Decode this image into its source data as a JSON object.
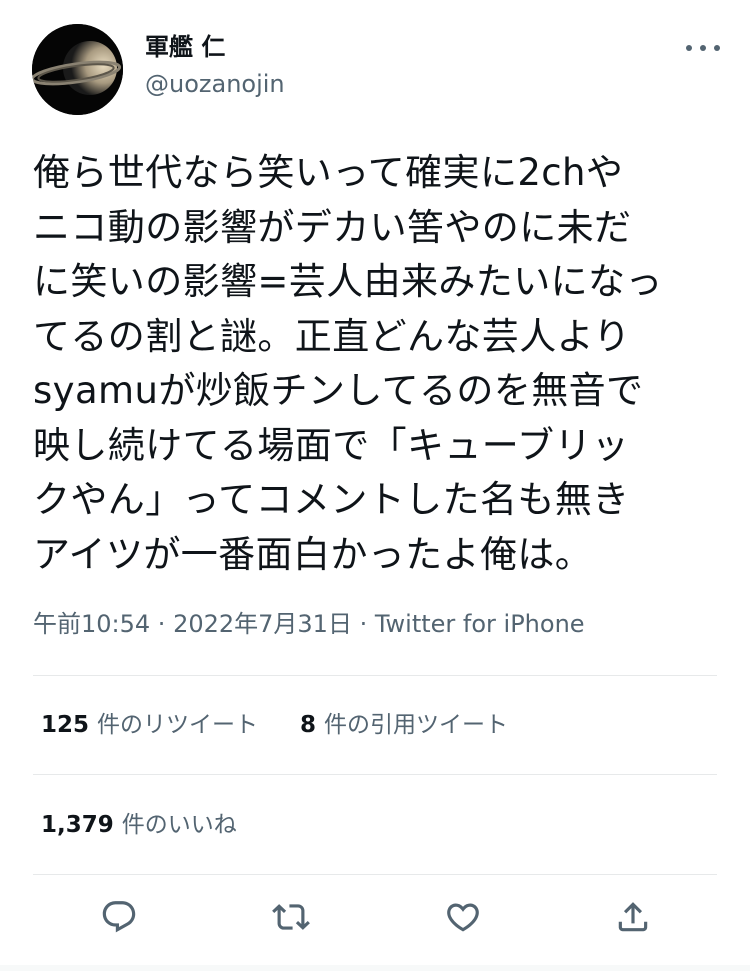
{
  "user": {
    "display_name": "軍艦 仁",
    "handle": "@uozanojin"
  },
  "tweet": {
    "text": "俺ら世代なら笑いって確実に2chや\nニコ動の影響がデカい筈やのに未だ\nに笑いの影響=芸人由来みたいになっ\nてるの割と謎。正直どんな芸人より\nsyamuが炒飯チンしてるのを無音で\n映し続けてる場面で「キューブリッ\nクやん」ってコメントした名も無き\nアイツが一番面白かったよ俺は。"
  },
  "meta": {
    "time": "午前10:54",
    "date": "2022年7月31日",
    "separator": " · ",
    "app": "Twitter for iPhone"
  },
  "stats": {
    "retweets_count": "125",
    "retweets_label": "件のリツイート",
    "quotes_count": "8",
    "quotes_label": "件の引用ツイート",
    "likes_count": "1,379",
    "likes_label": "件のいいね"
  },
  "icons": {
    "avatar": "saturn-image",
    "more": "more-horizontal-icon",
    "reply": "reply-icon",
    "retweet": "retweet-icon",
    "like": "heart-icon",
    "share": "share-icon"
  },
  "colors": {
    "text": "#0f1419",
    "secondary": "#536471",
    "divider": "#e7e9ea",
    "background": "#ffffff"
  }
}
